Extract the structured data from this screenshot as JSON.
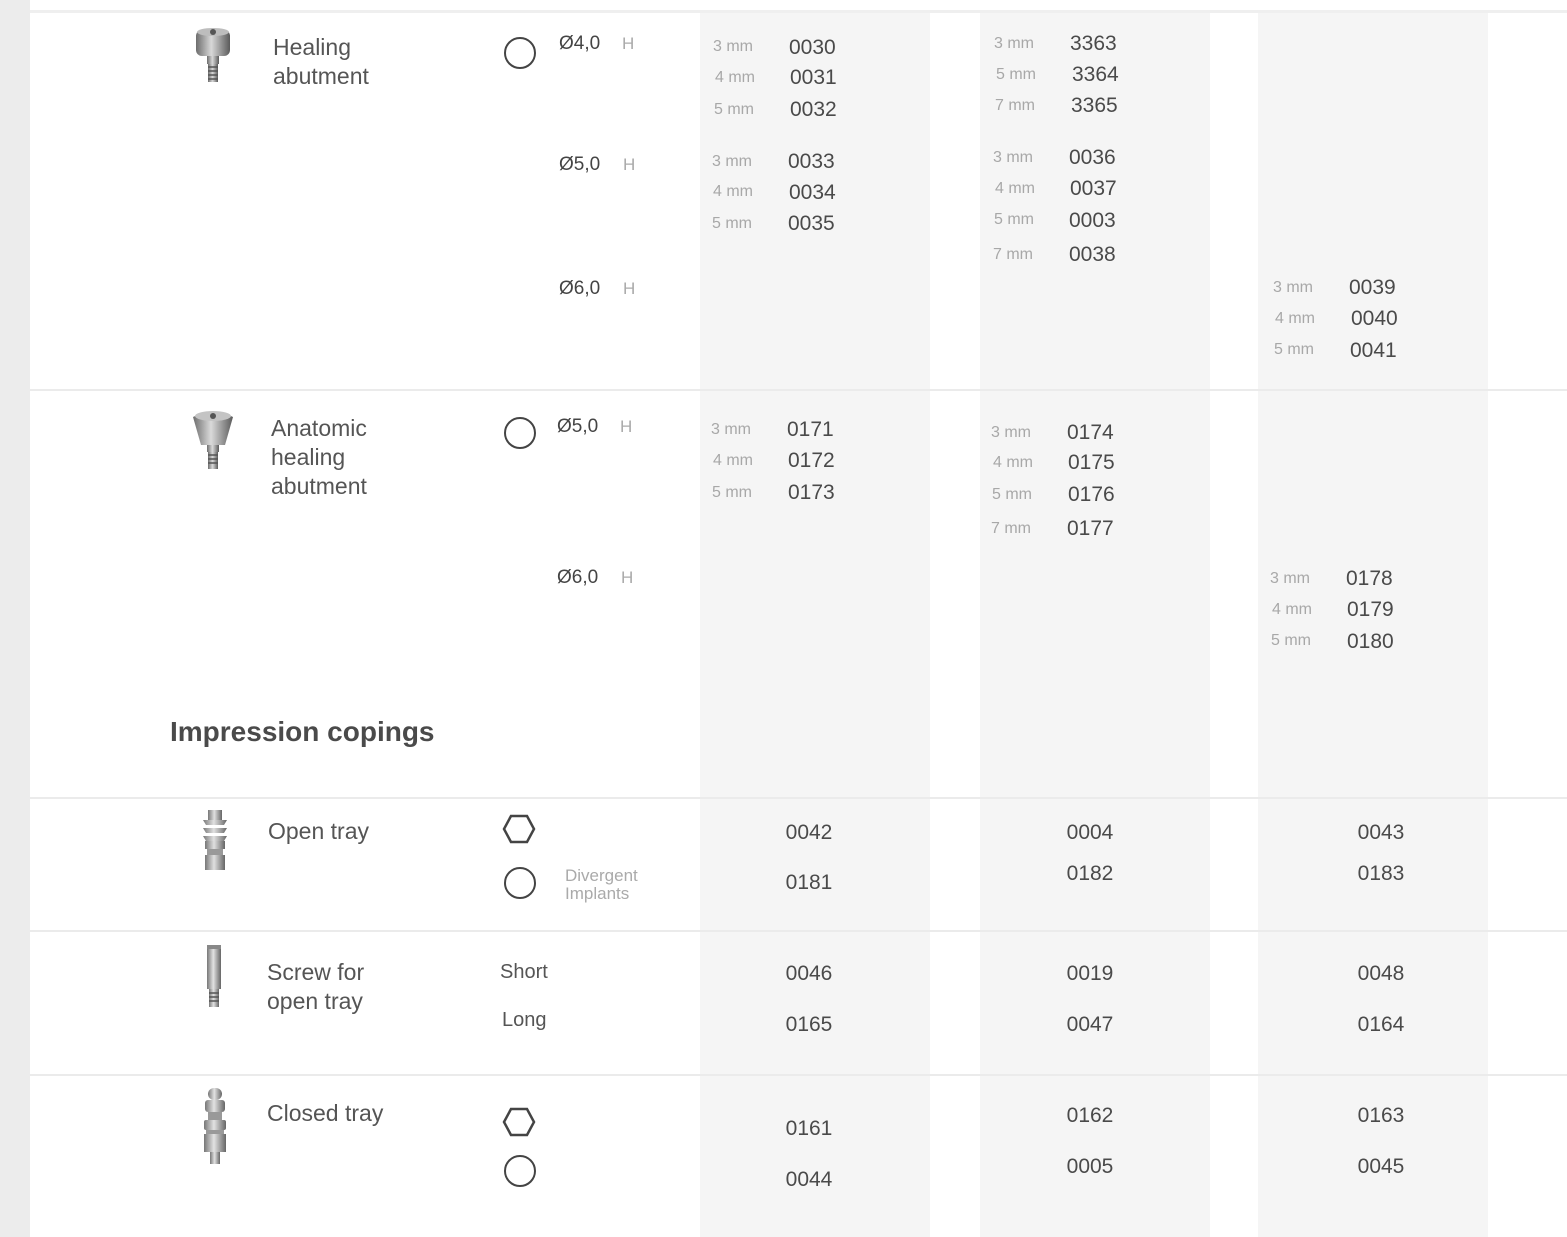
{
  "sections": {
    "impression_copings": "Impression copings"
  },
  "products": {
    "healing": {
      "name": "Healing\nabutment",
      "sizes": [
        {
          "diameter": "Ø4,0",
          "h": "H",
          "c1": [
            {
              "mm": "3 mm",
              "code": "0030"
            },
            {
              "mm": "4 mm",
              "code": "0031"
            },
            {
              "mm": "5 mm",
              "code": "0032"
            }
          ],
          "c2": [
            {
              "mm": "3 mm",
              "code": "3363"
            },
            {
              "mm": "5 mm",
              "code": "3364"
            },
            {
              "mm": "7 mm",
              "code": "3365"
            }
          ]
        },
        {
          "diameter": "Ø5,0",
          "h": "H",
          "c1": [
            {
              "mm": "3 mm",
              "code": "0033"
            },
            {
              "mm": "4 mm",
              "code": "0034"
            },
            {
              "mm": "5 mm",
              "code": "0035"
            }
          ],
          "c2": [
            {
              "mm": "3 mm",
              "code": "0036"
            },
            {
              "mm": "4 mm",
              "code": "0037"
            },
            {
              "mm": "5 mm",
              "code": "0003"
            },
            {
              "mm": "7 mm",
              "code": "0038"
            }
          ]
        },
        {
          "diameter": "Ø6,0",
          "h": "H",
          "c3": [
            {
              "mm": "3 mm",
              "code": "0039"
            },
            {
              "mm": "4 mm",
              "code": "0040"
            },
            {
              "mm": "5 mm",
              "code": "0041"
            }
          ]
        }
      ]
    },
    "anatomic": {
      "name": "Anatomic\nhealing\nabutment",
      "sizes": [
        {
          "diameter": "Ø5,0",
          "h": "H",
          "c1": [
            {
              "mm": "3 mm",
              "code": "0171"
            },
            {
              "mm": "4 mm",
              "code": "0172"
            },
            {
              "mm": "5 mm",
              "code": "0173"
            }
          ],
          "c2": [
            {
              "mm": "3 mm",
              "code": "0174"
            },
            {
              "mm": "4 mm",
              "code": "0175"
            },
            {
              "mm": "5 mm",
              "code": "0176"
            },
            {
              "mm": "7 mm",
              "code": "0177"
            }
          ]
        },
        {
          "diameter": "Ø6,0",
          "h": "H",
          "c3": [
            {
              "mm": "3 mm",
              "code": "0178"
            },
            {
              "mm": "4 mm",
              "code": "0179"
            },
            {
              "mm": "5 mm",
              "code": "0180"
            }
          ]
        }
      ]
    },
    "open_tray": {
      "name": "Open tray",
      "note": "Divergent\nImplants",
      "rows": [
        {
          "c1": "0042",
          "c2": "0004",
          "c3": "0043"
        },
        {
          "c1": "0181",
          "c2": "0182",
          "c3": "0183"
        }
      ]
    },
    "screw": {
      "name": "Screw for\nopen tray",
      "rows": [
        {
          "label": "Short",
          "c1": "0046",
          "c2": "0019",
          "c3": "0048"
        },
        {
          "label": "Long",
          "c1": "0165",
          "c2": "0047",
          "c3": "0164"
        }
      ]
    },
    "closed_tray": {
      "name": "Closed tray",
      "rows": [
        {
          "c1": "0161",
          "c2": "0162",
          "c3": "0163"
        },
        {
          "c1": "0044",
          "c2": "0005",
          "c3": "0045"
        }
      ]
    }
  }
}
